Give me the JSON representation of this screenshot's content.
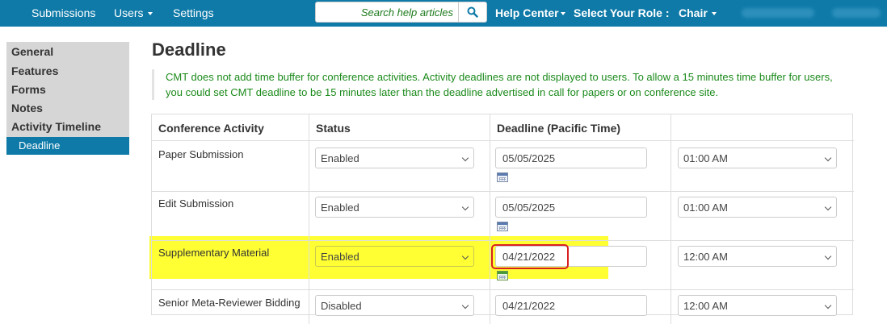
{
  "navbar": {
    "submissions": "Submissions",
    "users": "Users",
    "settings": "Settings",
    "search_placeholder": "Search help articles",
    "help_center": "Help Center",
    "select_role": "Select Your Role :",
    "role": "Chair"
  },
  "sidebar": {
    "items": [
      "General",
      "Features",
      "Forms",
      "Notes",
      "Activity Timeline"
    ],
    "active": "Deadline"
  },
  "page": {
    "title": "Deadline",
    "note": "CMT does not add time buffer for conference activities. Activity deadlines are not displayed to users. To allow a 15 minutes time buffer for users, you could set CMT deadline to be 15 minutes later than the deadline advertised in call for papers or on conference site."
  },
  "table": {
    "headers": [
      "Conference Activity",
      "Status",
      "Deadline (Pacific Time)"
    ],
    "rows": [
      {
        "activity": "Paper Submission",
        "status": "Enabled",
        "date": "05/05/2025",
        "time": "01:00 AM"
      },
      {
        "activity": "Edit Submission",
        "status": "Enabled",
        "date": "05/05/2025",
        "time": "01:00 AM"
      },
      {
        "activity": "Supplementary Material",
        "status": "Enabled",
        "date": "04/21/2022",
        "time": "12:00 AM"
      },
      {
        "activity": "Senior Meta-Reviewer Bidding",
        "status": "Disabled",
        "date": "04/21/2022",
        "time": "12:00 AM"
      }
    ]
  },
  "colors": {
    "navbar": "#0f7aa8",
    "note_text": "#1b8a1b",
    "highlight": "#ffff33",
    "red_outline": "#d92020"
  },
  "icons": [
    "search-icon",
    "calendar-icon",
    "chevron-down-icon",
    "caret-down-icon"
  ]
}
